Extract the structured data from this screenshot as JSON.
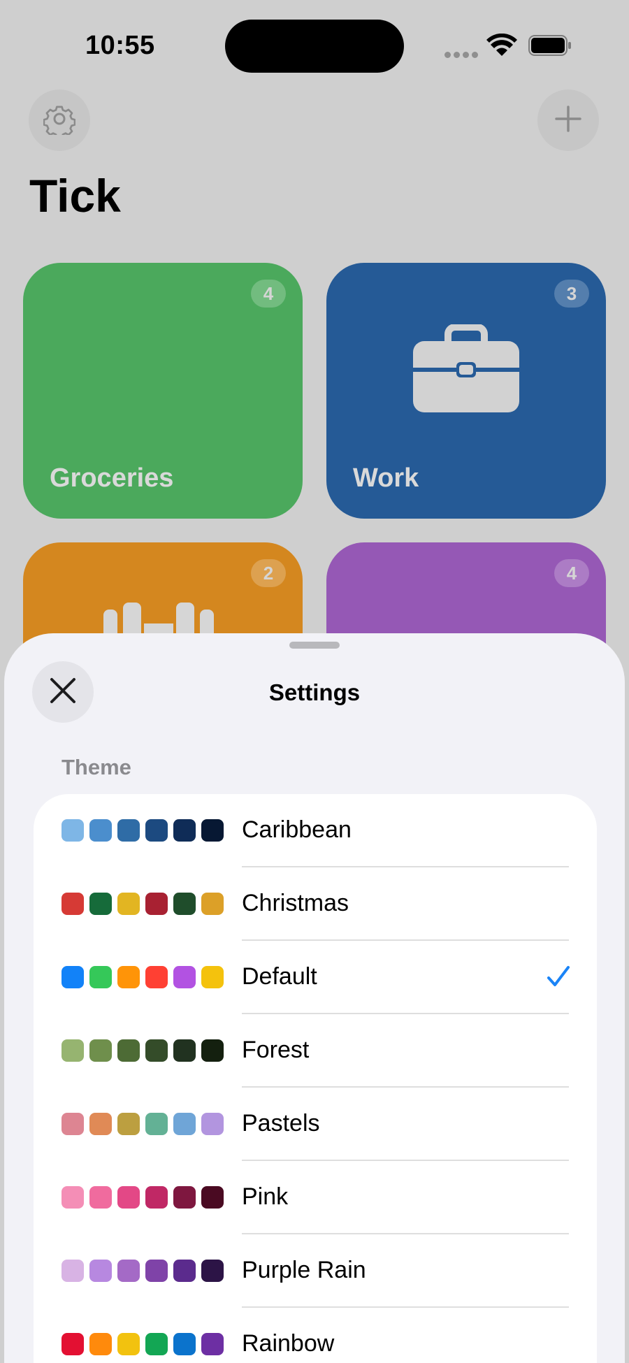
{
  "status_bar": {
    "time": "10:55"
  },
  "app": {
    "title": "Tick"
  },
  "tiles": [
    {
      "name": "Groceries",
      "count": "4",
      "color": "#4ba95c"
    },
    {
      "name": "Work",
      "count": "3",
      "color": "#255a96"
    },
    {
      "name": "",
      "count": "2",
      "color": "#d4871f"
    },
    {
      "name": "",
      "count": "4",
      "color": "#9558b5"
    }
  ],
  "sheet": {
    "title": "Settings",
    "section_header": "Theme",
    "themes": [
      {
        "name": "Caribbean",
        "selected": false,
        "colors": [
          "#7eb6e6",
          "#4b8ecd",
          "#2f6ca6",
          "#1c4a80",
          "#0f2c57",
          "#071833"
        ]
      },
      {
        "name": "Christmas",
        "selected": false,
        "colors": [
          "#d63a35",
          "#166b3a",
          "#e2b522",
          "#a82132",
          "#1f4d2b",
          "#dca028"
        ]
      },
      {
        "name": "Default",
        "selected": true,
        "colors": [
          "#1282f8",
          "#35c859",
          "#ff9408",
          "#ff4033",
          "#b252e2",
          "#f4c20d"
        ]
      },
      {
        "name": "Forest",
        "selected": false,
        "colors": [
          "#96b470",
          "#6f8f4c",
          "#4d6b35",
          "#344c29",
          "#213220",
          "#14200f"
        ]
      },
      {
        "name": "Pastels",
        "selected": false,
        "colors": [
          "#dd8592",
          "#e08a56",
          "#bc9f40",
          "#63b195",
          "#6fa5d7",
          "#b295df"
        ]
      },
      {
        "name": "Pink",
        "selected": false,
        "colors": [
          "#f48eb6",
          "#f06b9e",
          "#e34886",
          "#c02865",
          "#7e173f",
          "#4a0a22"
        ]
      },
      {
        "name": "Purple Rain",
        "selected": false,
        "colors": [
          "#d8b3e4",
          "#b788e0",
          "#a46ac6",
          "#7f43a8",
          "#5b2b8d",
          "#2c1446"
        ]
      },
      {
        "name": "Rainbow",
        "selected": false,
        "colors": [
          "#e31032",
          "#ff8a0c",
          "#f2c20f",
          "#13a654",
          "#0b73cc",
          "#6d2fa3"
        ]
      }
    ]
  }
}
